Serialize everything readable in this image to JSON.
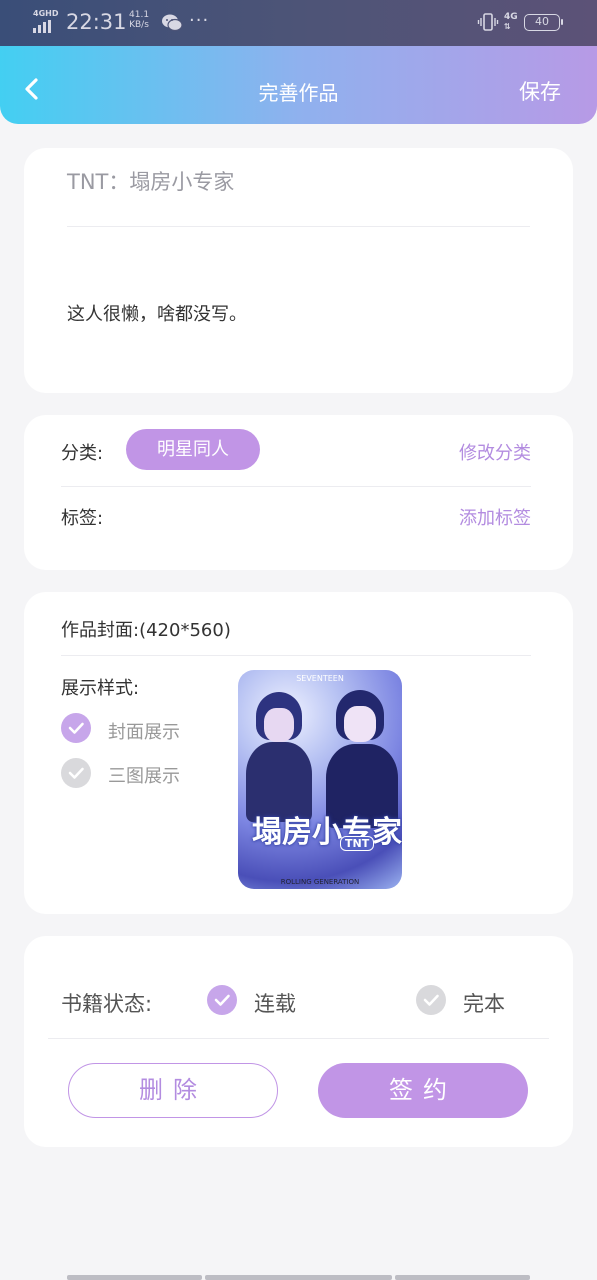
{
  "status_bar": {
    "network_label": "4GHD",
    "time": "22:31",
    "speed_value": "41.1",
    "speed_unit": "KB/s",
    "more": "···",
    "network_right": "4G",
    "battery": "40"
  },
  "header": {
    "title": "完善作品",
    "save_label": "保存"
  },
  "work": {
    "title": "TNT：塌房小专家",
    "intro": "这人很懒，啥都没写。"
  },
  "category": {
    "label": "分类:",
    "value": "明星同人",
    "edit_label": "修改分类"
  },
  "tags": {
    "label": "标签:",
    "add_label": "添加标签"
  },
  "cover": {
    "label": "作品封面:",
    "size": "(420*560)",
    "display_style_label": "展示样式:",
    "options": [
      {
        "label": "封面展示",
        "checked": true
      },
      {
        "label": "三图展示",
        "checked": false
      }
    ],
    "image": {
      "title_text": "塌房小专家",
      "badge_text": "TNT",
      "top_text": "SEVENTEEN",
      "bottom_text": "ROLLING GENERATION"
    }
  },
  "book_status": {
    "label": "书籍状态:",
    "options": [
      {
        "label": "连载",
        "checked": true
      },
      {
        "label": "完本",
        "checked": false
      }
    ]
  },
  "actions": {
    "delete_label": "删除",
    "sign_label": "签约"
  },
  "colors": {
    "accent": "#c195e6",
    "header_gradient_start": "#43cff2",
    "header_gradient_end": "#b79ae6",
    "check_on": "#c7a6ea",
    "check_off": "#d9d9dc"
  }
}
